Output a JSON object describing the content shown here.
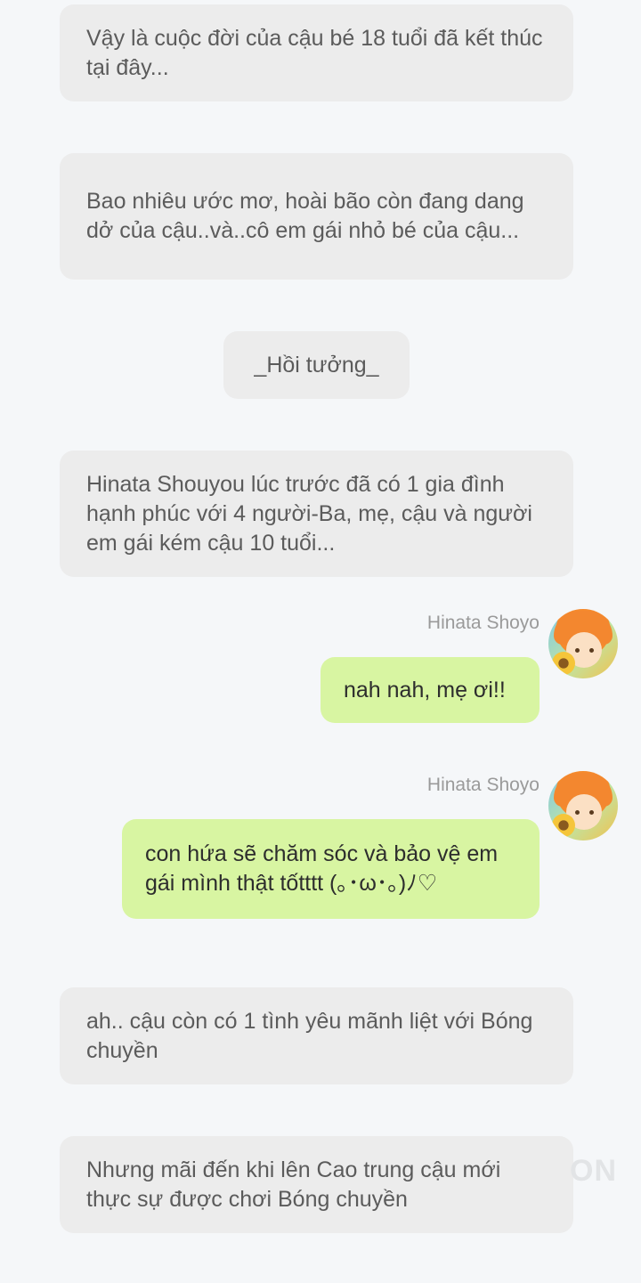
{
  "messages": {
    "narr1": "Vậy là cuộc đời của cậu bé 18 tuổi đã kết thúc tại đây...",
    "narr2": "Bao nhiêu ước mơ, hoài bão còn đang dang dở của cậu..và..cô em gái nhỏ bé của cậu...",
    "flashback": "_Hồi tưởng_",
    "narr3": "Hinata Shouyou lúc trước đã có 1 gia đình hạnh phúc với 4 người-Ba, mẹ, cậu và người em gái kém cậu 10 tuổi...",
    "chat1": {
      "sender": "Hinata Shoyo",
      "text": "nah nah, mẹ ơi!!"
    },
    "chat2": {
      "sender": "Hinata Shoyo",
      "text": "con hứa sẽ chăm sóc và bảo vệ em gái mình thật tốtttt (｡･ω･｡)ﾉ♡"
    },
    "narr4": "ah.. cậu còn có 1 tình yêu mãnh liệt với Bóng chuyền",
    "narr5": "Nhưng mãi đến khi lên Cao trung cậu mới thực sự được chơi Bóng chuyền"
  },
  "watermark": "ON",
  "colors": {
    "background": "#f5f7f9",
    "narration_bubble": "#ececec",
    "own_bubble": "#d8f5a2"
  }
}
